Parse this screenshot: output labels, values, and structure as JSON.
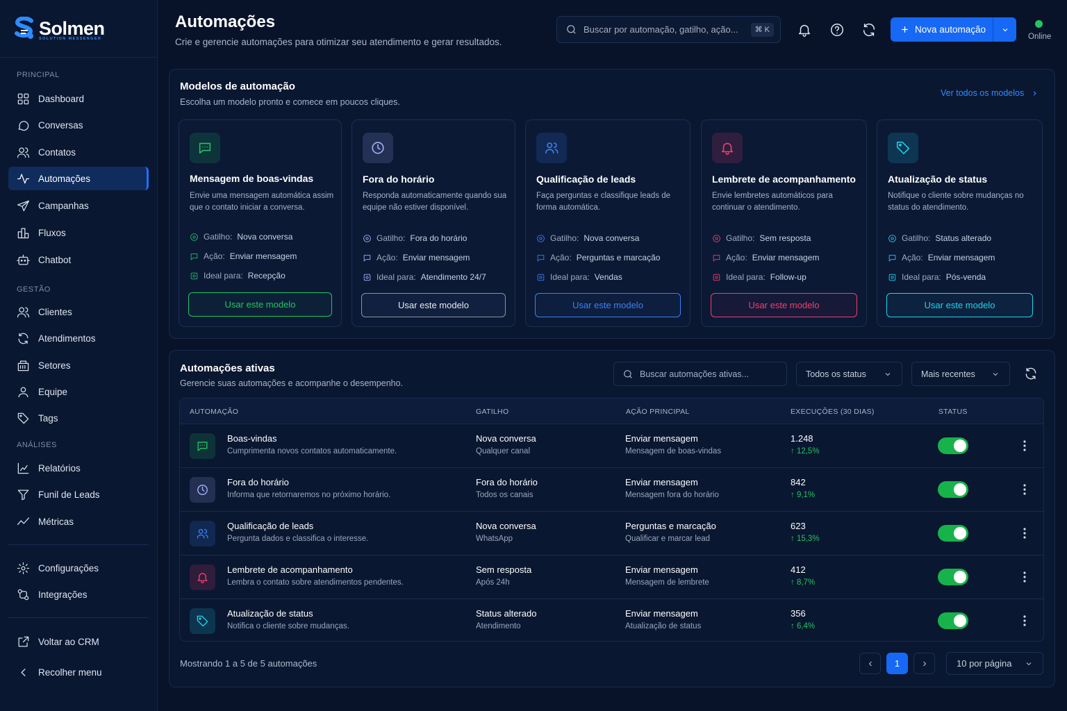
{
  "brand": {
    "name": "Solmen",
    "tagline": "SOLUTION MESSENGER"
  },
  "sidebar": {
    "sections": [
      {
        "label": "PRINCIPAL",
        "items": [
          {
            "label": "Dashboard",
            "icon": "grid-icon"
          },
          {
            "label": "Conversas",
            "icon": "chat-bubble-icon"
          },
          {
            "label": "Contatos",
            "icon": "users-icon"
          },
          {
            "label": "Automações",
            "icon": "activity-icon",
            "active": true
          },
          {
            "label": "Campanhas",
            "icon": "send-icon"
          },
          {
            "label": "Fluxos",
            "icon": "flow-icon"
          },
          {
            "label": "Chatbot",
            "icon": "bot-icon"
          }
        ]
      },
      {
        "label": "GESTÃO",
        "items": [
          {
            "label": "Clientes",
            "icon": "users-icon"
          },
          {
            "label": "Atendimentos",
            "icon": "refresh-icon"
          },
          {
            "label": "Setores",
            "icon": "building-icon"
          },
          {
            "label": "Equipe",
            "icon": "user-icon"
          },
          {
            "label": "Tags",
            "icon": "tag-icon"
          }
        ]
      },
      {
        "label": "ANÁLISES",
        "items": [
          {
            "label": "Relatórios",
            "icon": "chart-icon"
          },
          {
            "label": "Funil de Leads",
            "icon": "funnel-icon"
          },
          {
            "label": "Métricas",
            "icon": "trend-icon"
          }
        ]
      }
    ],
    "bottom": [
      {
        "label": "Configurações",
        "icon": "gear-icon"
      },
      {
        "label": "Integrações",
        "icon": "integration-icon"
      }
    ],
    "footer": [
      {
        "label": "Voltar ao CRM",
        "icon": "external-link-icon"
      },
      {
        "label": "Recolher menu",
        "icon": "chevron-left-icon"
      }
    ]
  },
  "header": {
    "title": "Automações",
    "subtitle": "Crie e gerencie automações para otimizar seu atendimento e gerar resultados.",
    "search_placeholder": "Buscar por automação, gatilho, ação...",
    "shortcut": "⌘ K",
    "new_button": "Nova automação",
    "status": "Online"
  },
  "templates": {
    "title": "Modelos de automação",
    "subtitle": "Escolha um modelo pronto e comece em poucos cliques.",
    "see_all": "Ver todos os modelos",
    "trigger_label": "Gatilho:",
    "action_label": "Ação:",
    "ideal_label": "Ideal para:",
    "cards": [
      {
        "title": "Mensagem de boas-vindas",
        "description": "Envie uma mensagem automática assim que o contato iniciar a conversa.",
        "trigger": "Nova conversa",
        "action": "Enviar mensagem",
        "ideal": "Recepção",
        "button": "Usar este modelo",
        "icon": "message-icon",
        "color": "#22c55e"
      },
      {
        "title": "Fora do horário",
        "description": "Responda automaticamente quando sua equipe não estiver disponível.",
        "trigger": "Fora do horário",
        "action": "Enviar mensagem",
        "ideal": "Atendimento 24/7",
        "button": "Usar este modelo",
        "icon": "clock-icon",
        "color": "#a5b4fc"
      },
      {
        "title": "Qualificação de leads",
        "description": "Faça perguntas e classifique leads de forma automática.",
        "trigger": "Nova conversa",
        "action": "Perguntas e marcação",
        "ideal": "Vendas",
        "button": "Usar este modelo",
        "icon": "users-icon",
        "color": "#3b82f6"
      },
      {
        "title": "Lembrete de acompanhamento",
        "description": "Envie lembretes automáticos para continuar o atendimento.",
        "trigger": "Sem resposta",
        "action": "Enviar mensagem",
        "ideal": "Follow-up",
        "button": "Usar este modelo",
        "icon": "bell-icon",
        "color": "#f43f6e"
      },
      {
        "title": "Atualização de status",
        "description": "Notifique o cliente sobre mudanças no status do atendimento.",
        "trigger": "Status alterado",
        "action": "Enviar mensagem",
        "ideal": "Pós-venda",
        "button": "Usar este modelo",
        "icon": "tag-icon",
        "color": "#22d3ee"
      }
    ]
  },
  "active": {
    "title": "Automações ativas",
    "subtitle": "Gerencie suas automações e acompanhe o desempenho.",
    "search_placeholder": "Buscar automações ativas...",
    "status_filter": "Todos os status",
    "sort": "Mais recentes",
    "columns": [
      "AUTOMAÇÃO",
      "GATILHO",
      "AÇÃO PRINCIPAL",
      "EXECUÇÕES (30 DIAS)",
      "STATUS"
    ],
    "rows": [
      {
        "name": "Boas-vindas",
        "desc": "Cumprimenta novos contatos automaticamente.",
        "trigger": "Nova conversa",
        "trigger_sub": "Qualquer canal",
        "action": "Enviar mensagem",
        "action_sub": "Mensagem de boas-vindas",
        "executions": "1.248",
        "growth": "↑ 12,5%",
        "enabled": true,
        "icon": "message-icon",
        "color": "#22c55e"
      },
      {
        "name": "Fora do horário",
        "desc": "Informa que retornaremos no próximo horário.",
        "trigger": "Fora do horário",
        "trigger_sub": "Todos os canais",
        "action": "Enviar mensagem",
        "action_sub": "Mensagem fora do horário",
        "executions": "842",
        "growth": "↑ 9,1%",
        "enabled": true,
        "icon": "clock-icon",
        "color": "#a5b4fc"
      },
      {
        "name": "Qualificação de leads",
        "desc": "Pergunta dados e classifica o interesse.",
        "trigger": "Nova conversa",
        "trigger_sub": "WhatsApp",
        "action": "Perguntas e marcação",
        "action_sub": "Qualificar e marcar lead",
        "executions": "623",
        "growth": "↑ 15,3%",
        "enabled": true,
        "icon": "users-icon",
        "color": "#3b82f6"
      },
      {
        "name": "Lembrete de acompanhamento",
        "desc": "Lembra o contato sobre atendimentos pendentes.",
        "trigger": "Sem resposta",
        "trigger_sub": "Após 24h",
        "action": "Enviar mensagem",
        "action_sub": "Mensagem de lembrete",
        "executions": "412",
        "growth": "↑ 8,7%",
        "enabled": true,
        "icon": "bell-icon",
        "color": "#f43f6e"
      },
      {
        "name": "Atualização de status",
        "desc": "Notifica o cliente sobre mudanças.",
        "trigger": "Status alterado",
        "trigger_sub": "Atendimento",
        "action": "Enviar mensagem",
        "action_sub": "Atualização de status",
        "executions": "356",
        "growth": "↑ 6,4%",
        "enabled": true,
        "icon": "tag-icon",
        "color": "#22d3ee"
      }
    ],
    "showing": "Mostrando 1 a 5 de 5 automações",
    "page": "1",
    "per_page": "10 por página"
  }
}
